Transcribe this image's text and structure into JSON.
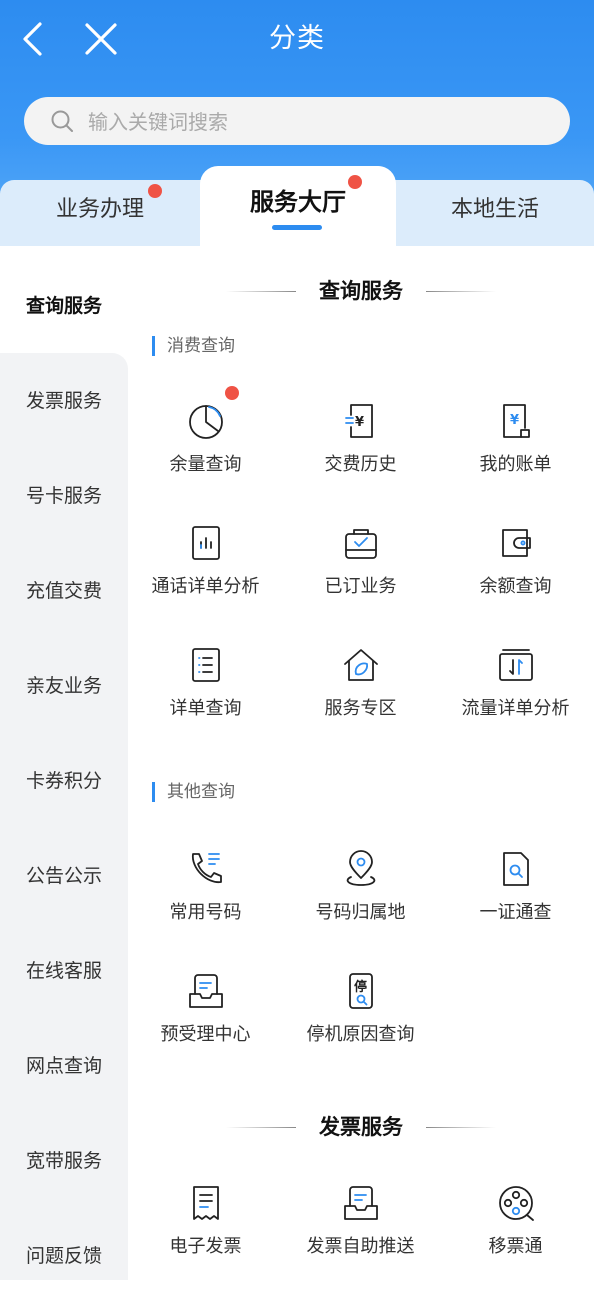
{
  "header": {
    "title": "分类",
    "search_placeholder": "输入关键词搜索",
    "bg_color": "#2d8cf0"
  },
  "tabs": [
    {
      "label": "业务办理",
      "active": false,
      "badge": true
    },
    {
      "label": "服务大厅",
      "active": true,
      "badge": true
    },
    {
      "label": "本地生活",
      "active": false,
      "badge": false
    }
  ],
  "sidebar": {
    "items": [
      {
        "label": "查询服务",
        "active": true
      },
      {
        "label": "发票服务"
      },
      {
        "label": "号卡服务"
      },
      {
        "label": "充值交费"
      },
      {
        "label": "亲友业务"
      },
      {
        "label": "卡券积分"
      },
      {
        "label": "公告公示"
      },
      {
        "label": "在线客服"
      },
      {
        "label": "网点查询"
      },
      {
        "label": "宽带服务"
      },
      {
        "label": "问题反馈"
      }
    ]
  },
  "sections": [
    {
      "title": "查询服务",
      "groups": [
        {
          "title": "消费查询",
          "items": [
            {
              "label": "余量查询",
              "icon": "pie-chart-icon",
              "badge": true
            },
            {
              "label": "交费历史",
              "icon": "yuan-receipt-icon"
            },
            {
              "label": "我的账单",
              "icon": "bill-icon"
            },
            {
              "label": "通话详单分析",
              "icon": "bar-chart-doc-icon"
            },
            {
              "label": "已订业务",
              "icon": "bag-check-icon"
            },
            {
              "label": "余额查询",
              "icon": "wallet-icon"
            },
            {
              "label": "详单查询",
              "icon": "list-doc-icon"
            },
            {
              "label": "服务专区",
              "icon": "home-leaf-icon"
            },
            {
              "label": "流量详单分析",
              "icon": "data-transfer-icon"
            }
          ]
        },
        {
          "title": "其他查询",
          "items": [
            {
              "label": "常用号码",
              "icon": "phone-list-icon"
            },
            {
              "label": "号码归属地",
              "icon": "location-pin-icon"
            },
            {
              "label": "一证通查",
              "icon": "doc-search-icon"
            },
            {
              "label": "预受理中心",
              "icon": "tray-doc-icon"
            },
            {
              "label": "停机原因查询",
              "icon": "phone-search-icon"
            }
          ]
        }
      ]
    },
    {
      "title": "发票服务",
      "items": [
        {
          "label": "电子发票",
          "icon": "invoice-icon"
        },
        {
          "label": "发票自助推送",
          "icon": "invoice-push-icon"
        },
        {
          "label": "移票通",
          "icon": "film-reel-icon"
        }
      ]
    }
  ],
  "icon_glyphs": {
    "yuan": "¥",
    "stop": "停"
  }
}
